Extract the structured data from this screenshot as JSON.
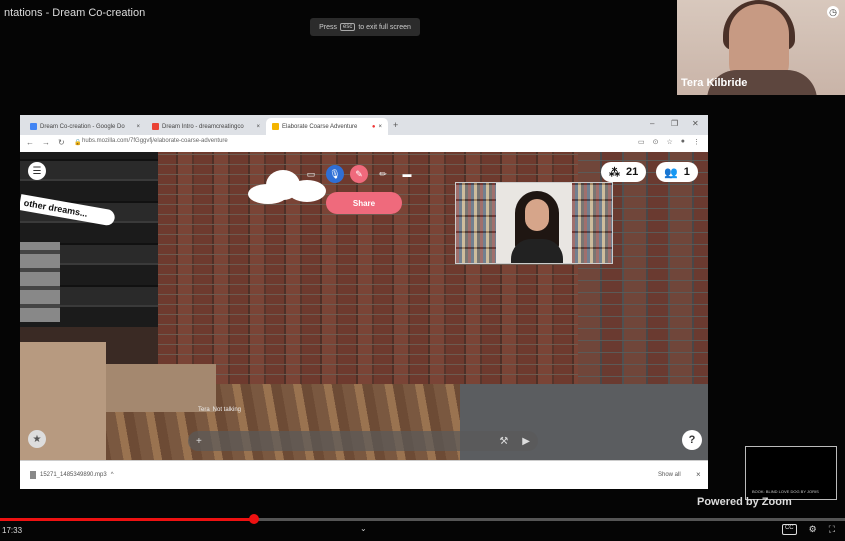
{
  "window": {
    "title": "ntations - Dream Co-creation",
    "esc_tip_prefix": "Press",
    "esc_key": "esc",
    "esc_tip_suffix": "to exit full screen"
  },
  "zoom": {
    "participant_name": "Tera Kilbride",
    "powered_by": "Powered by Zoom",
    "mini_caption": "BOOK: BLIND LOVE DOG BY JORIS"
  },
  "browser": {
    "tabs": [
      {
        "label": "Dream Co-creation - Google Do",
        "icon_color": "#4285f4"
      },
      {
        "label": "Dream Intro - dreamcreatingco",
        "icon_color": "#ea4335"
      },
      {
        "label": "Elaborate Coarse Adventure",
        "icon_color": "#f4b400",
        "active": true
      }
    ],
    "url": "hubs.mozilla.com/7fGggvfj/elaborate-coarse-adventure",
    "nav_icons": [
      "back-icon",
      "forward-icon",
      "reload-icon"
    ]
  },
  "hubs": {
    "sign_text": "other dreams...",
    "share_label": "Share",
    "room_count": "21",
    "people_count": "1",
    "nametag": "Tera",
    "nametag_suffix": "Not talking",
    "help_label": "?"
  },
  "downloads": {
    "file_name": "15271_1485349890.mp3",
    "show_all": "Show all"
  },
  "player": {
    "time": "17:33",
    "progress": 0.3
  },
  "colors": {
    "accent_red": "#e11111",
    "hubs_pink": "#ef6a7c",
    "hubs_blue": "#2f6fd6"
  }
}
